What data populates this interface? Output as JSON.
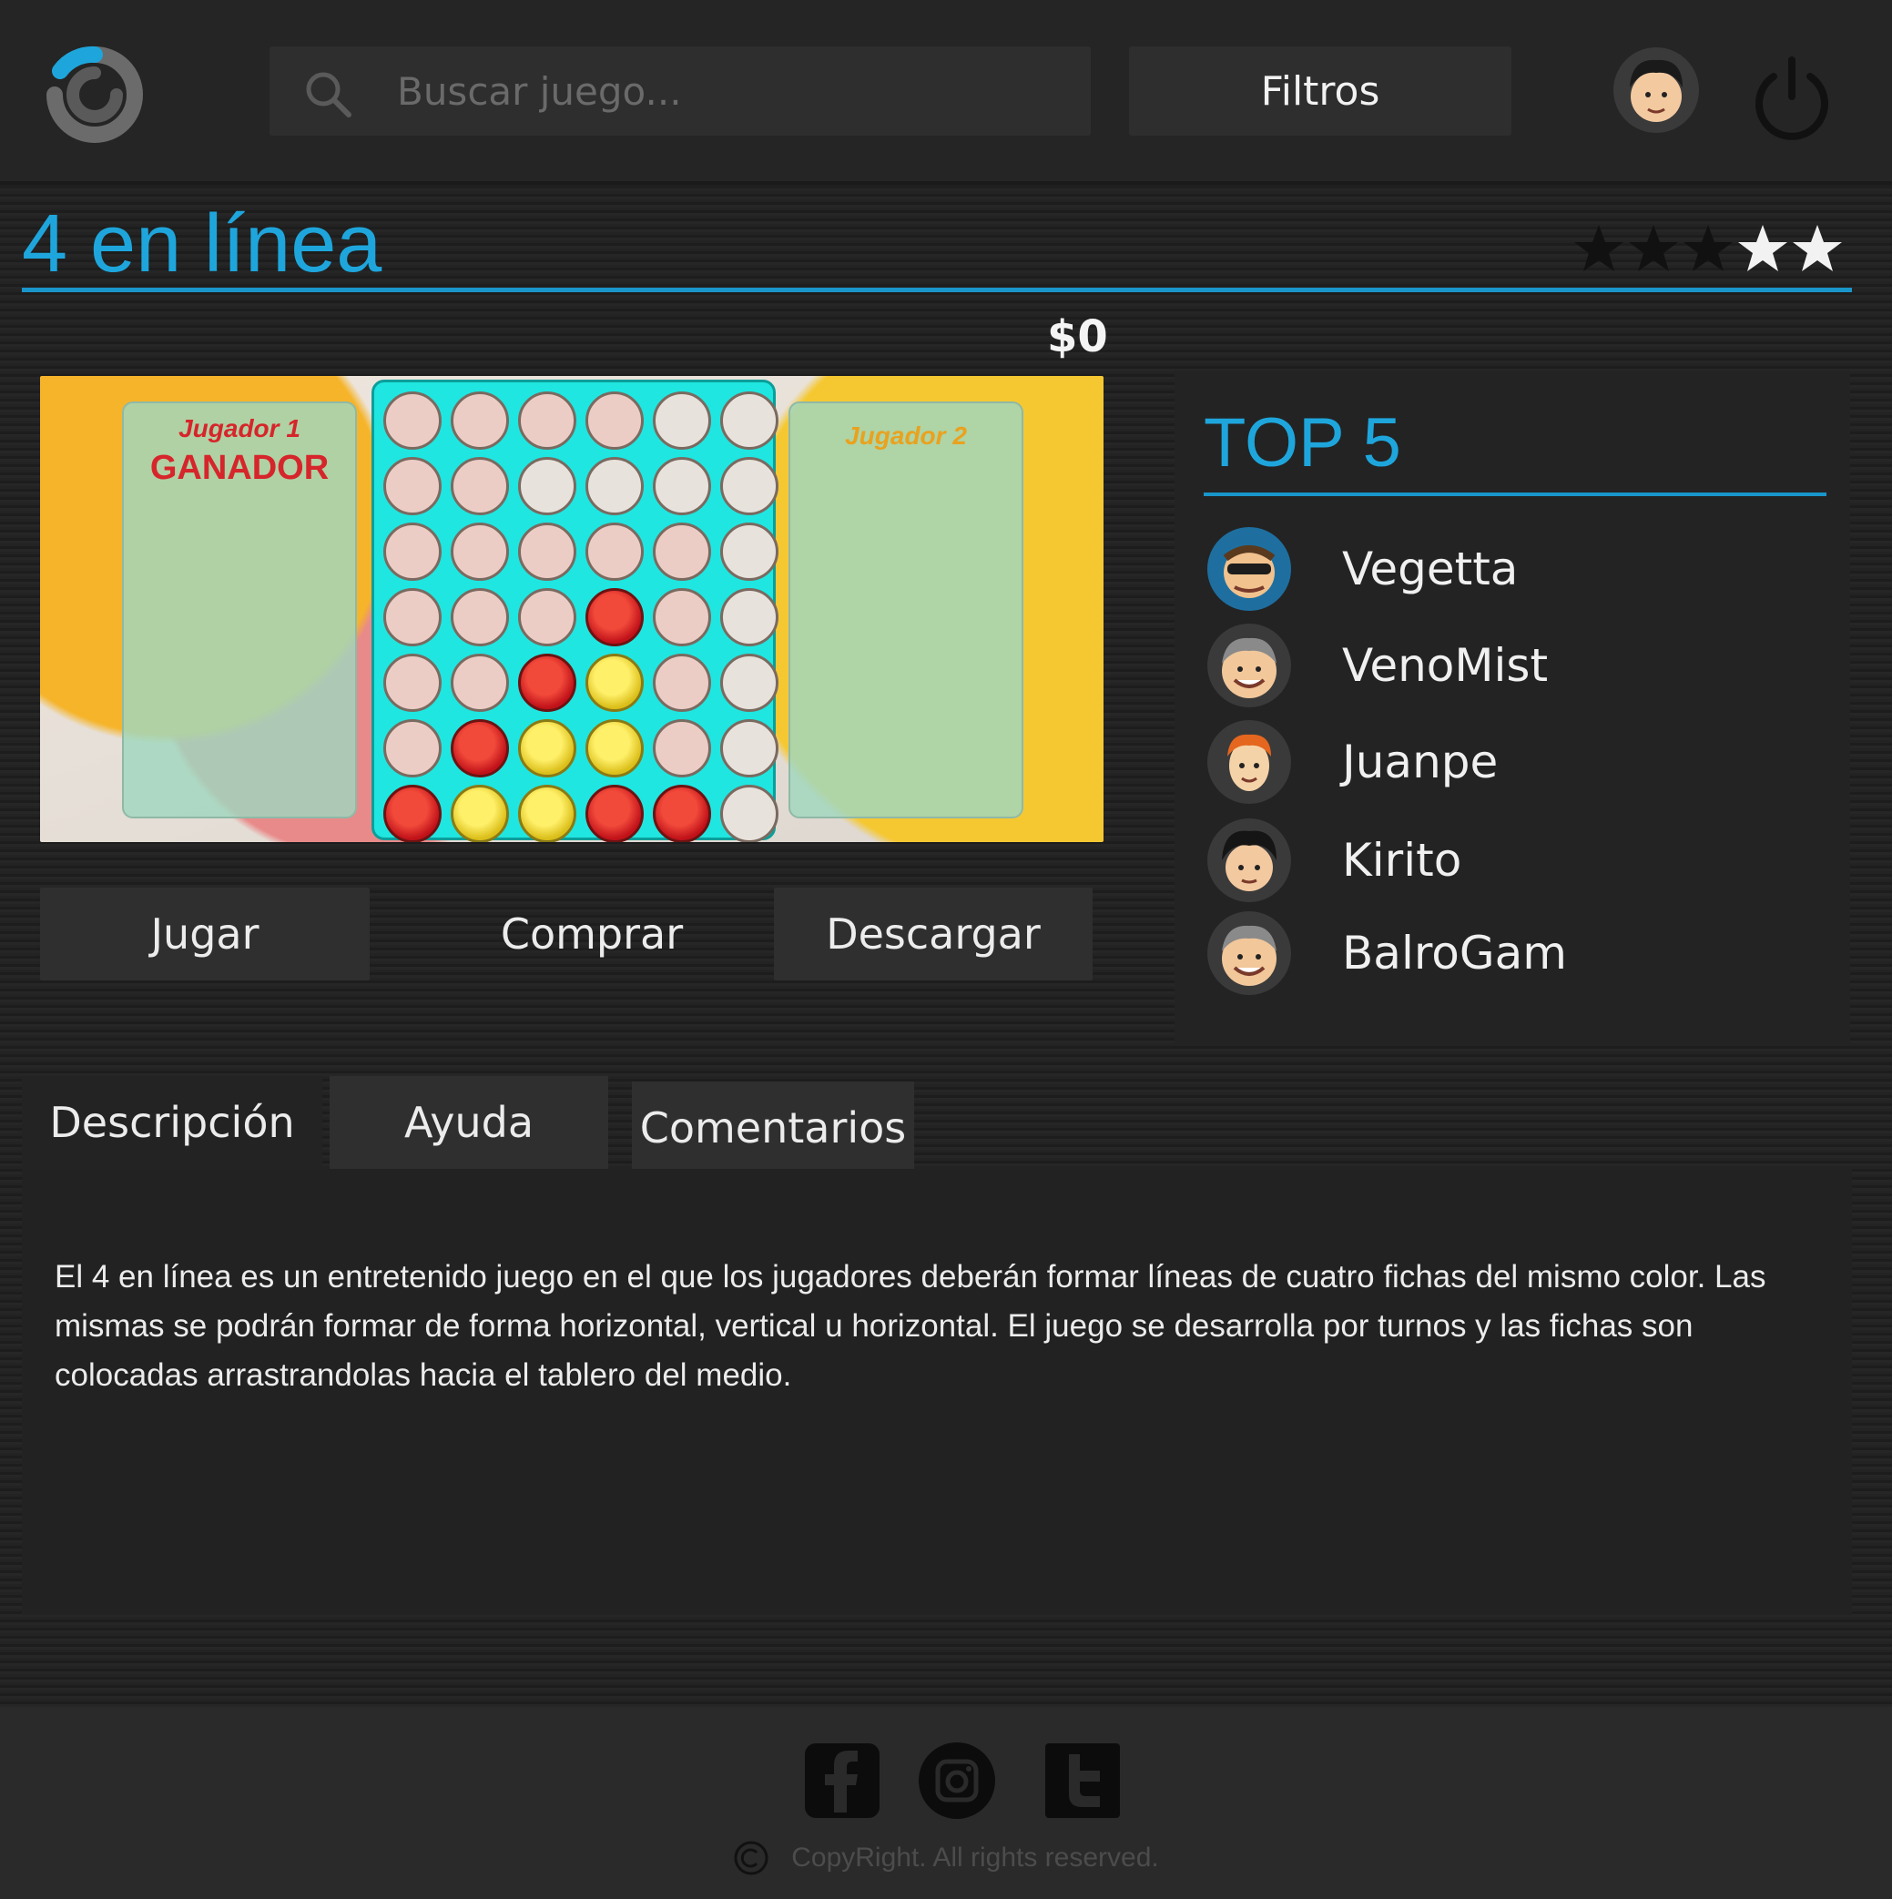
{
  "header": {
    "search_placeholder": "Buscar juego...",
    "filters_label": "Filtros",
    "icons": [
      "logo-icon",
      "search-icon",
      "user-avatar",
      "power-icon"
    ]
  },
  "game": {
    "title": "4 en línea",
    "rating": 3,
    "rating_max": 5,
    "price": "$0",
    "screenshot": {
      "player1_label": "Jugador 1",
      "player1_status": "GANADOR",
      "player2_label": "Jugador 2"
    },
    "actions": {
      "play": "Jugar",
      "buy": "Comprar",
      "download": "Descargar"
    }
  },
  "top5": {
    "title": "TOP 5",
    "players": [
      {
        "name": "Vegetta"
      },
      {
        "name": "VenoMist"
      },
      {
        "name": "Juanpe"
      },
      {
        "name": "Kirito"
      },
      {
        "name": "BalroGam"
      }
    ]
  },
  "tabs": {
    "description": "Descripción",
    "help": "Ayuda",
    "comments": "Comentarios"
  },
  "description_text": " El 4 en línea es un entretenido juego en el que los jugadores deberán formar líneas de cuatro fichas del mismo color. Las mismas se podrán formar de forma horizontal, vertical u horizontal. El juego se desarrolla por turnos y las fichas son colocadas arrastrandolas hacia el tablero del medio.",
  "footer": {
    "social": [
      "facebook-icon",
      "instagram-icon",
      "twitter-icon"
    ],
    "copyright": "CopyRight. All rights reserved."
  },
  "colors": {
    "accent": "#1ea6dc",
    "background": "#1f1f1f",
    "panel": "#2f2f2f"
  }
}
